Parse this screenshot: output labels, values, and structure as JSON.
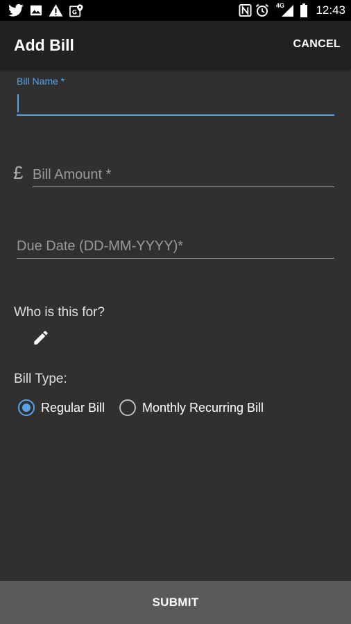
{
  "status_bar": {
    "time": "12:43",
    "network_label": "4G",
    "left_icons": [
      "twitter-icon",
      "image-icon",
      "warning-icon",
      "maps-icon"
    ],
    "right_icons": [
      "nfc-icon",
      "alarm-icon",
      "signal-icon",
      "battery-icon"
    ]
  },
  "app_bar": {
    "title": "Add Bill",
    "cancel_label": "CANCEL"
  },
  "form": {
    "bill_name": {
      "label": "Bill Name *",
      "value": ""
    },
    "bill_amount": {
      "currency_symbol": "£",
      "placeholder": "Bill Amount *"
    },
    "due_date": {
      "placeholder": "Due Date (DD-MM-YYYY)*"
    },
    "who_for": {
      "label": "Who is this for?",
      "edit_icon": "pencil-icon"
    },
    "bill_type": {
      "label": "Bill Type:",
      "options": [
        {
          "label": "Regular Bill",
          "checked": true
        },
        {
          "label": "Monthly Recurring Bill",
          "checked": false
        }
      ]
    }
  },
  "submit_label": "SUBMIT",
  "colors": {
    "accent": "#5aa3e6",
    "background": "#303030",
    "app_bar": "#212121",
    "submit_bar": "#5a5a5a"
  }
}
